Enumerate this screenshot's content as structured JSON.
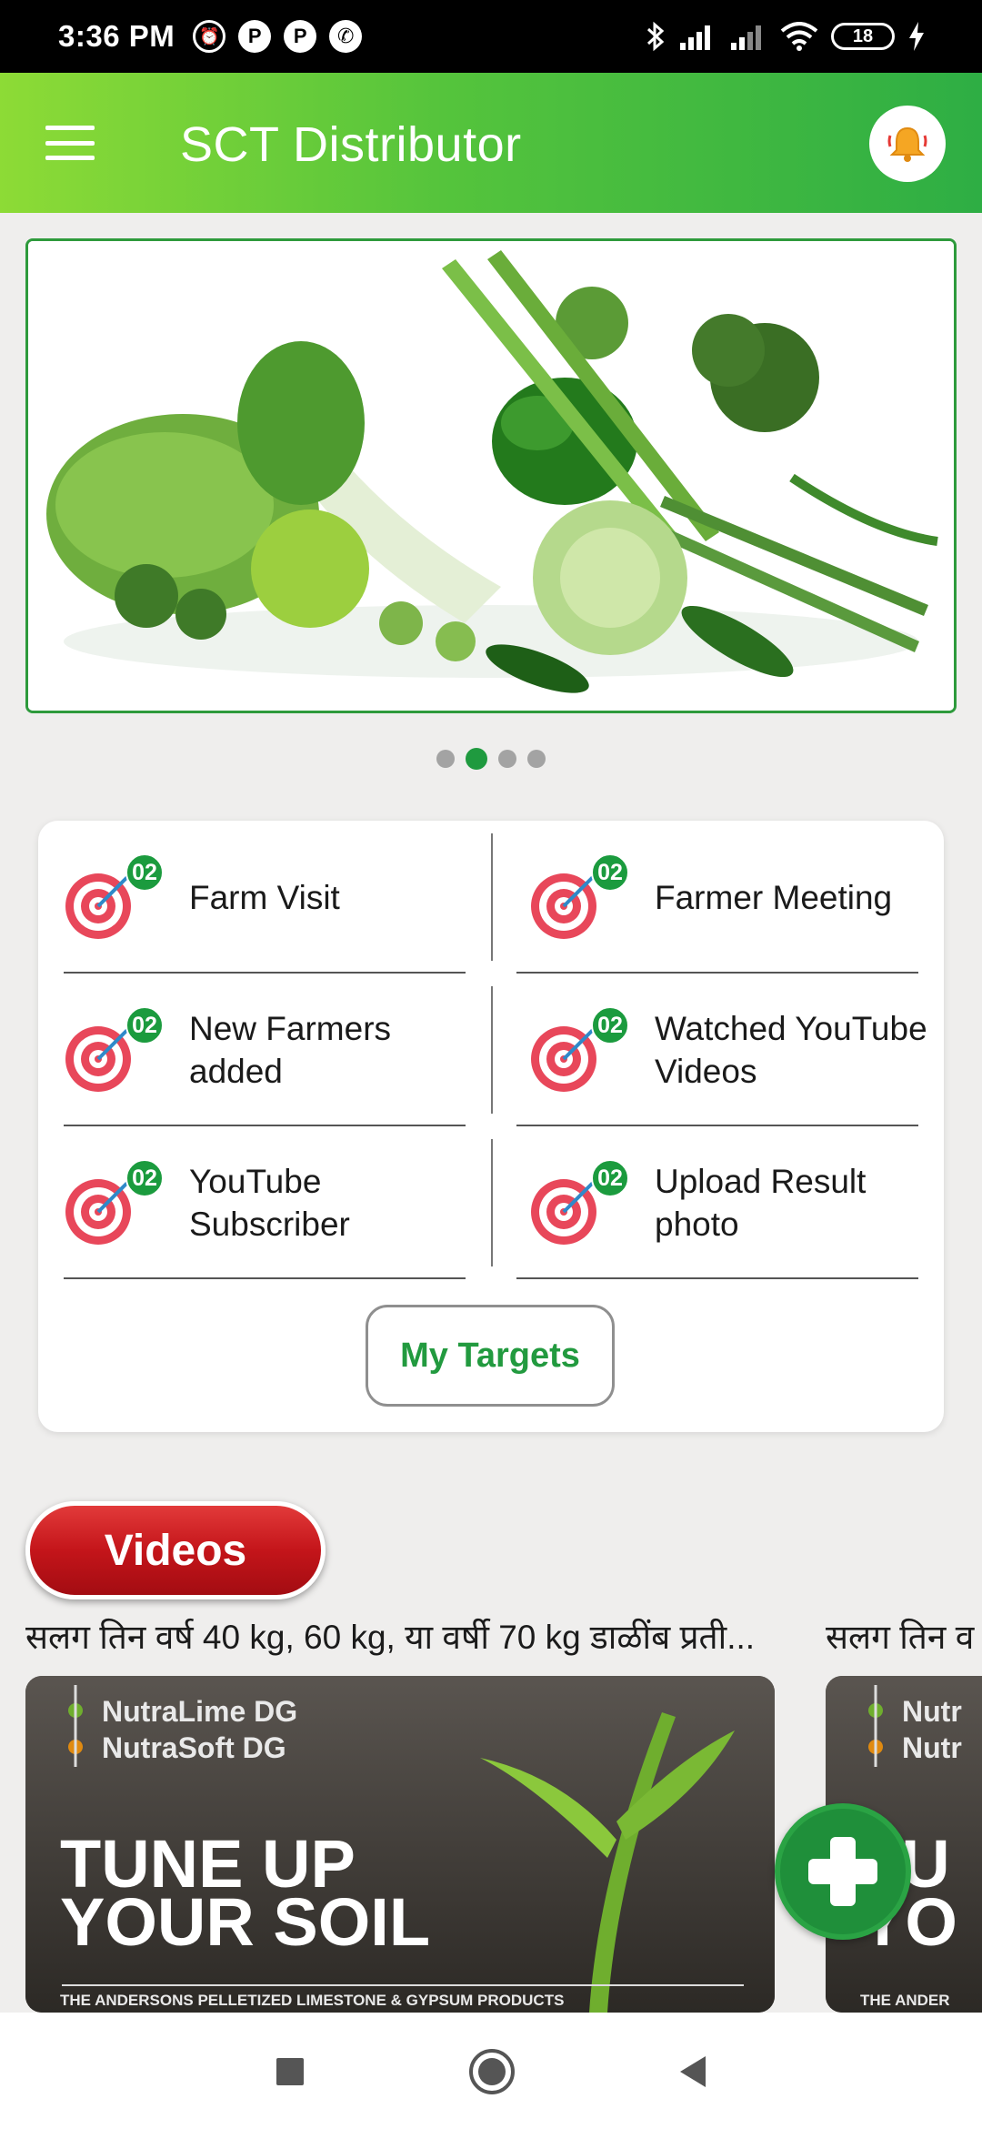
{
  "status_bar": {
    "time": "3:36 PM",
    "battery": "18"
  },
  "app_bar": {
    "title": "SCT Distributor"
  },
  "banner": {
    "slide_count": 4,
    "active_slide": 2
  },
  "targets": {
    "items": [
      {
        "label": "Farm Visit",
        "badge": "02"
      },
      {
        "label": "Farmer Meeting",
        "badge": "02"
      },
      {
        "label": "New Farmers added",
        "badge": "02"
      },
      {
        "label": "Watched YouTube Videos",
        "badge": "02"
      },
      {
        "label": "YouTube Subscriber",
        "badge": "02"
      },
      {
        "label": "Upload Result photo",
        "badge": "02"
      }
    ],
    "button_label": "My Targets"
  },
  "videos": {
    "section_label": "Videos",
    "items": [
      {
        "title": "सलग तिन वर्ष 40 kg, 60 kg, या वर्षी 70 kg डाळींब प्रती...",
        "thumb_line1": "NutraLime DG",
        "thumb_line2": "NutraSoft DG",
        "thumb_headline1": "TUNE UP",
        "thumb_headline2": "YOUR SOIL",
        "thumb_caption": "THE ANDERSONS PELLETIZED LIMESTONE & GYPSUM PRODUCTS"
      },
      {
        "title": "सलग तिन व",
        "thumb_line1": "Nutr",
        "thumb_line2": "Nutr",
        "thumb_headline1": "TU",
        "thumb_headline2": "YO",
        "thumb_caption": "THE ANDER"
      }
    ]
  },
  "colors": {
    "brand_green": "#2eae44",
    "accent_red": "#c4151a",
    "badge_green": "#1b9b3e"
  }
}
